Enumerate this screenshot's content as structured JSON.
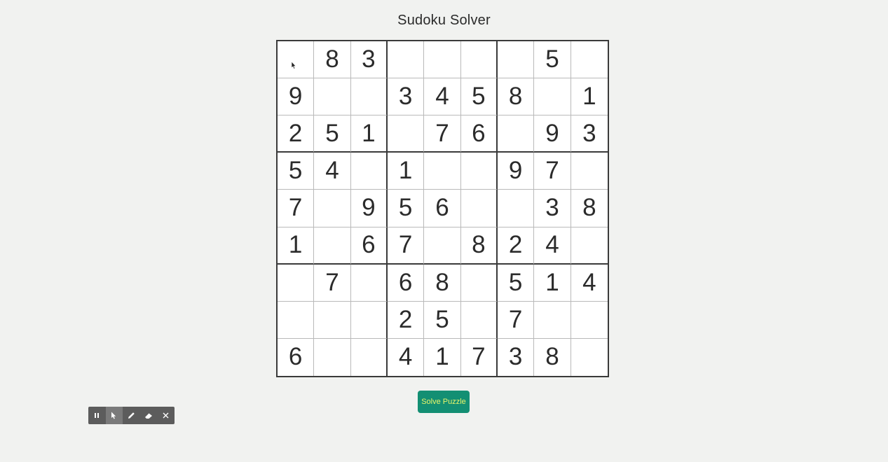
{
  "page": {
    "title": "Sudoku Solver"
  },
  "board": {
    "cells": [
      [
        "",
        "8",
        "3",
        "",
        "",
        "",
        "",
        "5",
        ""
      ],
      [
        "9",
        "",
        "",
        "3",
        "4",
        "5",
        "8",
        "",
        "1"
      ],
      [
        "2",
        "5",
        "1",
        "",
        "7",
        "6",
        "",
        "9",
        "3"
      ],
      [
        "5",
        "4",
        "",
        "1",
        "",
        "",
        "9",
        "7",
        ""
      ],
      [
        "7",
        "",
        "9",
        "5",
        "6",
        "",
        "",
        "3",
        "8"
      ],
      [
        "1",
        "",
        "6",
        "7",
        "",
        "8",
        "2",
        "4",
        ""
      ],
      [
        "",
        "7",
        "",
        "6",
        "8",
        "",
        "5",
        "1",
        "4"
      ],
      [
        "",
        "",
        "",
        "2",
        "5",
        "",
        "7",
        "",
        ""
      ],
      [
        "6",
        "",
        "",
        "4",
        "1",
        "7",
        "3",
        "8",
        ""
      ]
    ]
  },
  "actions": {
    "solve_label": "Solve Puzzle"
  },
  "toolbar": {
    "tools": [
      {
        "icon": "pause-icon",
        "active": false
      },
      {
        "icon": "pointer-icon",
        "active": true
      },
      {
        "icon": "pen-icon",
        "active": false
      },
      {
        "icon": "eraser-icon",
        "active": false
      },
      {
        "icon": "close-icon",
        "active": false
      }
    ]
  },
  "colors": {
    "background": "#f1f2f0",
    "button_bg": "#138f73",
    "button_text": "#e8f56a",
    "toolbar_bg": "#5c5c5c"
  }
}
